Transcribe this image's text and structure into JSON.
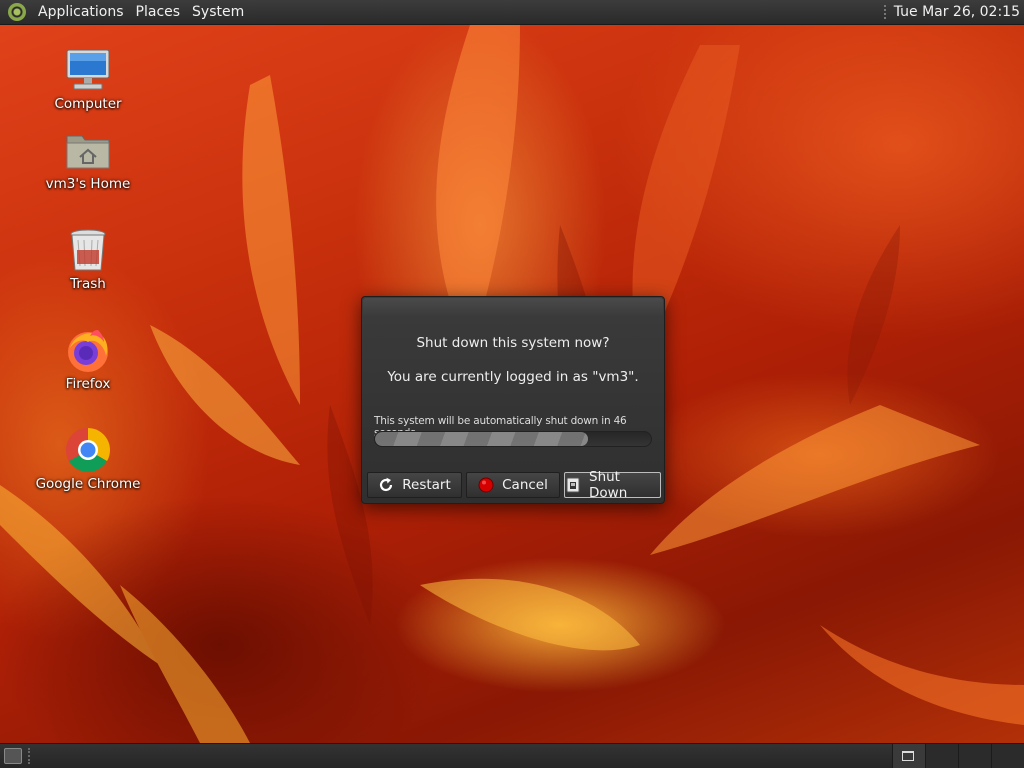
{
  "top_panel": {
    "menus": [
      "Applications",
      "Places",
      "System"
    ],
    "clock": "Tue Mar 26, 02:15"
  },
  "desktop": {
    "icons": [
      {
        "label": "Computer",
        "icon": "computer-icon"
      },
      {
        "label": "vm3's Home",
        "icon": "home-folder-icon"
      },
      {
        "label": "Trash",
        "icon": "trash-icon"
      },
      {
        "label": "Firefox",
        "icon": "firefox-icon"
      },
      {
        "label": "Google Chrome",
        "icon": "chrome-icon"
      }
    ]
  },
  "dialog": {
    "question": "Shut down this system now?",
    "logged_in": "You are currently logged in as \"vm3\".",
    "countdown": "This system will be automatically shut down in 46 seconds",
    "progress": 0.77,
    "buttons": {
      "restart": "Restart",
      "cancel": "Cancel",
      "shutdown": "Shut Down"
    }
  },
  "colors": {
    "panel": "#2e2e2e",
    "dialog": "#353535",
    "wallpaper_base": "#c02a08",
    "cancel_red": "#d40000"
  }
}
